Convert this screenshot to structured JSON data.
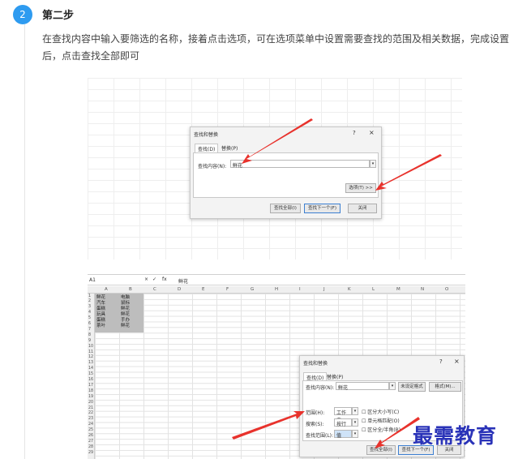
{
  "step": {
    "number": "2",
    "title": "第二步",
    "description": "在查找内容中输入要筛选的名称，接着点击选项，可在选项菜单中设置需要查找的范围及相关数据，完成设置后，点击查找全部即可"
  },
  "dialog1": {
    "title": "查找和替换",
    "help": "?",
    "close": "×",
    "tabs": [
      "查找(D)",
      "替换(P)"
    ],
    "find_label": "查找内容(N):",
    "find_value": "鲜花",
    "options_btn": "选项(T) >>",
    "buttons": [
      "查找全部(I)",
      "查找下一个(F)",
      "关闭"
    ]
  },
  "sheet": {
    "name_box": "A1",
    "formula_icons": [
      "×",
      "✓",
      "fx"
    ],
    "formula_value": "鲜花",
    "columns": [
      "A",
      "B",
      "C",
      "D",
      "E",
      "F",
      "G",
      "H",
      "I",
      "J",
      "K",
      "L",
      "M",
      "N",
      "O"
    ],
    "rows": [
      "1",
      "2",
      "3",
      "4",
      "5",
      "6",
      "7",
      "8",
      "9",
      "10",
      "11",
      "12",
      "13",
      "14",
      "15",
      "16",
      "17",
      "18",
      "19",
      "20",
      "21",
      "22",
      "23",
      "24",
      "25",
      "26",
      "27",
      "28",
      "29"
    ],
    "cells": [
      [
        "鲜花",
        "电脑"
      ],
      [
        "汽车",
        "鼠标"
      ],
      [
        "蛋糕",
        "鲜花"
      ],
      [
        "玩具",
        "鲜花"
      ],
      [
        "蛋糕",
        "手办"
      ],
      [
        "茶叶",
        "鲜花"
      ]
    ]
  },
  "dialog2": {
    "title": "查找和替换",
    "help": "?",
    "close": "×",
    "tabs": [
      "查找(D)",
      "替换(P)"
    ],
    "find_label": "查找内容(N):",
    "find_value": "鲜花",
    "no_format": "未设定格式",
    "format_btn": "格式(M)...",
    "scope_label": "范围(H):",
    "scope_value": "工作表",
    "search_label": "搜索(S):",
    "search_value": "按行",
    "lookin_label": "查找范围(L):",
    "lookin_value": "值",
    "checks": [
      "区分大小写(C)",
      "单元格匹配(O)",
      "区分全/半角(B)"
    ],
    "buttons": [
      "查找全部(I)",
      "查找下一个(F)",
      "关闭"
    ]
  },
  "watermark": "最需教育",
  "colors": {
    "badge": "#2e9bf0",
    "arrow": "#e8322c",
    "watermark": "#2a33b8"
  }
}
